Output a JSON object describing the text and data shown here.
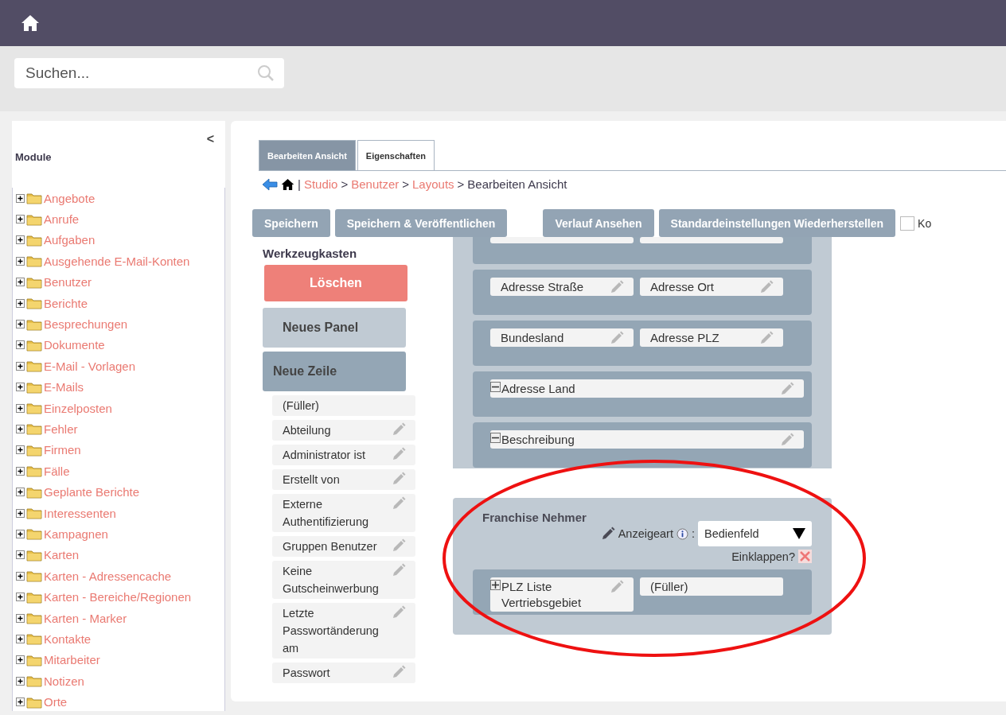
{
  "search": {
    "placeholder": "Suchen..."
  },
  "sidebar": {
    "title": "Module",
    "collapse": "<",
    "items": [
      {
        "label": "Angebote",
        "expanded": false
      },
      {
        "label": "Anrufe",
        "expanded": false
      },
      {
        "label": "Aufgaben",
        "expanded": false
      },
      {
        "label": "Ausgehende E-Mail-Konten",
        "expanded": false
      },
      {
        "label": "Benutzer",
        "expanded": false
      },
      {
        "label": "Berichte",
        "expanded": false
      },
      {
        "label": "Besprechungen",
        "expanded": false
      },
      {
        "label": "Dokumente",
        "expanded": false
      },
      {
        "label": "E-Mail - Vorlagen",
        "expanded": false
      },
      {
        "label": "E-Mails",
        "expanded": false
      },
      {
        "label": "Einzelposten",
        "expanded": false
      },
      {
        "label": "Fehler",
        "expanded": false
      },
      {
        "label": "Firmen",
        "expanded": false
      },
      {
        "label": "Fälle",
        "expanded": false
      },
      {
        "label": "Geplante Berichte",
        "expanded": false
      },
      {
        "label": "Interessenten",
        "expanded": false
      },
      {
        "label": "Kampagnen",
        "expanded": false
      },
      {
        "label": "Karten",
        "expanded": false
      },
      {
        "label": "Karten - Adressencache",
        "expanded": false
      },
      {
        "label": "Karten - Bereiche/Regionen",
        "expanded": false
      },
      {
        "label": "Karten - Marker",
        "expanded": false
      },
      {
        "label": "Kontakte",
        "expanded": false
      },
      {
        "label": "Mitarbeiter",
        "expanded": false
      },
      {
        "label": "Notizen",
        "expanded": false
      },
      {
        "label": "Orte",
        "expanded": false
      }
    ]
  },
  "tabs": [
    {
      "label": "Bearbeiten Ansicht",
      "selected": true
    },
    {
      "label": "Eigenschaften",
      "selected": false
    }
  ],
  "breadcrumb": {
    "divider": "|",
    "items": [
      {
        "label": "Studio",
        "link": true,
        "separator": ">"
      },
      {
        "label": "Benutzer",
        "link": true,
        "separator": ">"
      },
      {
        "label": "Layouts",
        "link": true,
        "separator": ">"
      },
      {
        "label": "Bearbeiten Ansicht",
        "link": false
      }
    ]
  },
  "buttons_left": [
    "Speichern",
    "Speichern & Veröffentlichen"
  ],
  "buttons_right": [
    "Verlauf Ansehen",
    "Standardeinstellungen Wiederherstellen"
  ],
  "option": {
    "label": "Ko",
    "checked": false
  },
  "toolbox": {
    "title": "Werkzeugkasten",
    "delete": "Löschen",
    "new_panel": "Neues Panel",
    "new_row": "Neue Zeile",
    "fields": [
      {
        "label": "(Füller)",
        "editable": false
      },
      {
        "label": "Abteilung",
        "editable": true
      },
      {
        "label": "Administrator ist",
        "editable": true
      },
      {
        "label": "Erstellt von",
        "editable": true
      },
      {
        "label": "Externe Authentifizierung",
        "editable": true
      },
      {
        "label": "Gruppen Benutzer",
        "editable": true
      },
      {
        "label": "Keine Gutscheinwerbung",
        "editable": true
      },
      {
        "label": "Letzte Passwortänderung am",
        "editable": true
      },
      {
        "label": "Passwort",
        "editable": true
      }
    ]
  },
  "layout": {
    "rows": [
      {
        "kind": "clipped"
      },
      {
        "kind": "pair",
        "fields": [
          {
            "label": "Adresse Straße",
            "editable": true
          },
          {
            "label": "Adresse Ort",
            "editable": true
          }
        ]
      },
      {
        "kind": "pair",
        "fields": [
          {
            "label": "Bundesland",
            "editable": true
          },
          {
            "label": "Adresse PLZ",
            "editable": true
          }
        ]
      },
      {
        "kind": "wide",
        "fields": [
          {
            "label": "Adresse Land",
            "editable": true,
            "expanded": true
          }
        ]
      },
      {
        "kind": "wide",
        "fields": [
          {
            "label": "Beschreibung",
            "editable": true,
            "expanded": true
          }
        ]
      }
    ]
  },
  "panel": {
    "title": "Franchise Nehmer",
    "display_label": "Anzeigeart",
    "display_suffix": ":",
    "display_value": "Bedienfeld",
    "collapse_label": "Einklappen?",
    "collapse": false,
    "rows": [
      {
        "kind": "pair",
        "fields": [
          {
            "label": "PLZ Liste Vertriebsgebiet",
            "editable": true,
            "expanded": false
          },
          {
            "label": "(Füller)",
            "editable": false
          }
        ]
      }
    ]
  }
}
